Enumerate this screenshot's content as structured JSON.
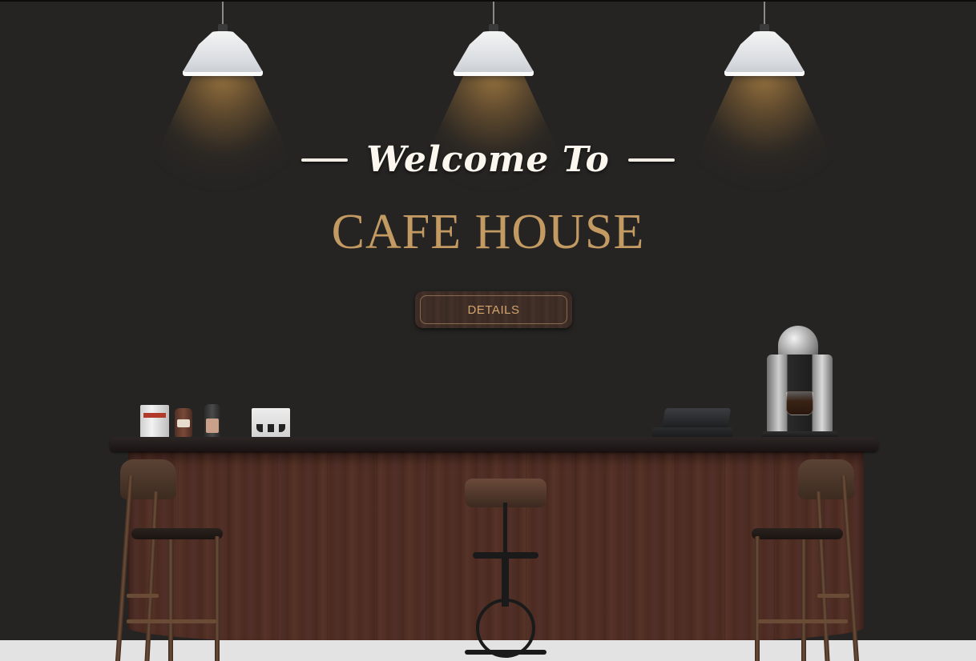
{
  "hero": {
    "welcome_text": "Welcome To",
    "title": "CAFE HOUSE",
    "details_button_label": "DETAILS"
  },
  "colors": {
    "background": "#252423",
    "title": "#c29a62",
    "welcome": "#fbf7ef",
    "button_text": "#d4a56c",
    "counter_wood": "#4c2a20",
    "floor": "#e3e3e3"
  },
  "lamps": [
    {
      "name": "pendant-lamp-left"
    },
    {
      "name": "pendant-lamp-center"
    },
    {
      "name": "pendant-lamp-right"
    }
  ]
}
